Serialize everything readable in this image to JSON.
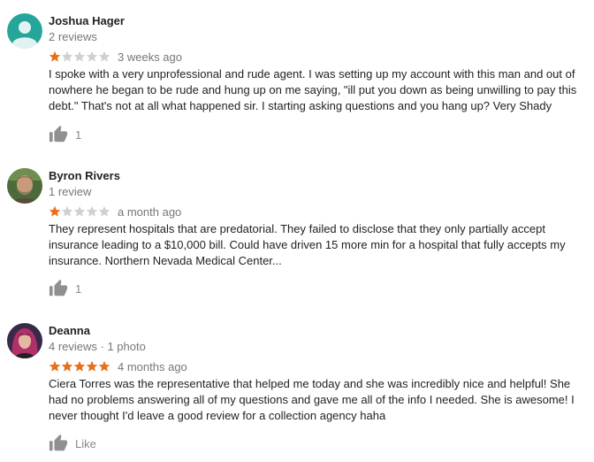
{
  "colors": {
    "star_filled": "#e7711b",
    "star_empty": "#d0d0d0",
    "text": "#222222",
    "muted": "#777777",
    "like_icon": "#909090"
  },
  "reviews": [
    {
      "name": "Joshua Hager",
      "meta": "2 reviews",
      "rating": 1,
      "date": "3 weeks ago",
      "body": "I spoke with a very unprofessional and rude agent. I was setting up my account with this man and out of nowhere he began to be rude and hung up on me saying, \"ill put you down as being unwilling to pay this debt.\" That's not at all what happened sir. I starting asking questions and you hang up? Very Shady",
      "like_label": "1",
      "avatar": "default-person-avatar"
    },
    {
      "name": "Byron Rivers",
      "meta": "1 review",
      "rating": 1,
      "date": "a month ago",
      "body": "They represent hospitals that are predatorial.  They failed to disclose that they only partially accept insurance leading to a $10,000 bill.  Could have driven 15 more min for a hospital that fully accepts my insurance.  Northern Nevada Medical Center...",
      "like_label": "1",
      "avatar": "photo-avatar-man"
    },
    {
      "name": "Deanna",
      "meta": "4 reviews · 1 photo",
      "rating": 5,
      "date": "4 months ago",
      "body": "Ciera Torres was the representative that helped me today and she was incredibly nice and helpful! She had no problems answering all of my questions and gave me all of the info I needed. She is awesome! I never thought I'd leave a good review for a collection agency haha",
      "like_label": "Like",
      "avatar": "photo-avatar-woman"
    }
  ]
}
